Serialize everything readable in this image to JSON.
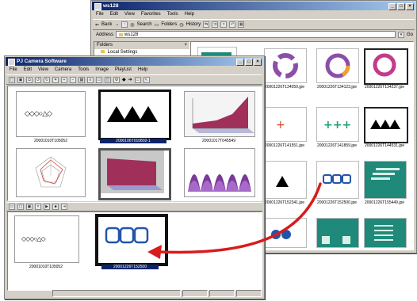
{
  "explorer": {
    "title": "ws128",
    "menu": [
      "File",
      "Edit",
      "View",
      "Favorites",
      "Tools",
      "Help"
    ],
    "toolbar": {
      "back": "Back",
      "search": "Search",
      "folders": "Folders",
      "history": "History"
    },
    "address_label": "Address",
    "address_value": "ws128",
    "folders_label": "Folders",
    "folder_item": "Local Settings",
    "thumbs_row1": [
      "20001226T134059.jpe",
      "20001226T134123.jpe",
      "20001226T134237.jpe"
    ],
    "thumbs_row2": [
      "20001226T141551.jpe",
      "20001226T141859.jpe",
      "20001226T144531.jpe"
    ],
    "thumbs_row3": [
      "20001226T152341.jpe",
      "20001226T152500.jpe",
      "20001226T155449.jpe"
    ],
    "colors": {
      "accent": "#1f8a7a",
      "arrow": "#d81b1b",
      "titlebar": "#0a246a"
    }
  },
  "camera": {
    "title": "PJ Camera Software",
    "menu": [
      "File",
      "Edit",
      "View",
      "Camera",
      "Tools",
      "Image",
      "PlayList",
      "Help"
    ],
    "thumbs_top": [
      "20001010T105052",
      "2000106T010802-1",
      "20001017T045549"
    ],
    "thumbs_bottom": [
      "",
      "",
      ""
    ],
    "playlist": [
      "20001010T105052",
      "20001226T152500"
    ]
  },
  "icons": [
    "folder-icon",
    "disk-icon",
    "back-arrow-icon",
    "search-icon",
    "close-icon",
    "minimize-icon",
    "maximize-icon"
  ]
}
